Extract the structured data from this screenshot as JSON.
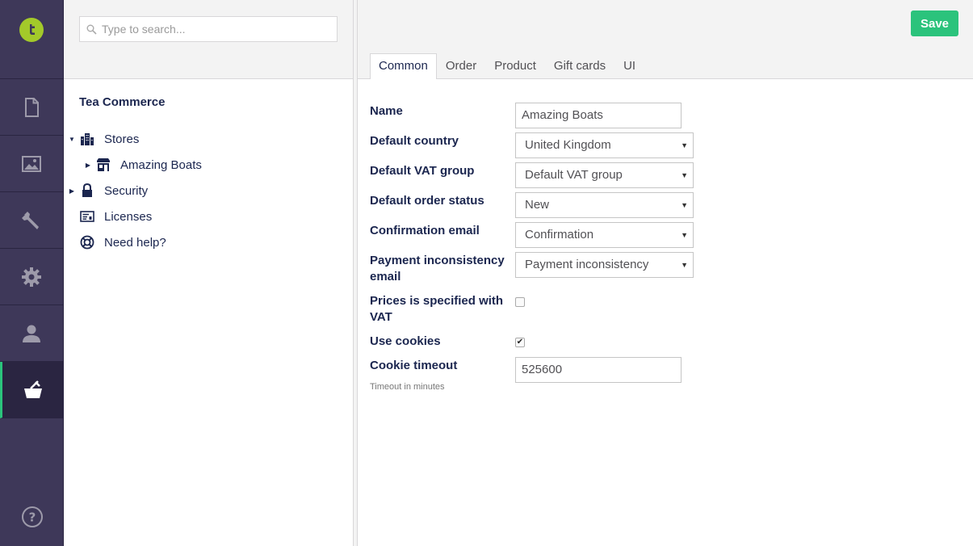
{
  "sections": {
    "logo": "logo-icon",
    "items": [
      {
        "name": "content",
        "icon": "document-icon"
      },
      {
        "name": "media",
        "icon": "image-icon"
      },
      {
        "name": "settings",
        "icon": "wrench-icon"
      },
      {
        "name": "developer",
        "icon": "gear-icon"
      },
      {
        "name": "users",
        "icon": "user-icon"
      },
      {
        "name": "tea-commerce",
        "icon": "basket-icon",
        "active": true
      }
    ],
    "help_icon": "question-icon"
  },
  "tree": {
    "search_placeholder": "Type to search...",
    "title": "Tea Commerce",
    "nodes": [
      {
        "label": "Stores",
        "icon": "stores-icon",
        "expanded": true
      },
      {
        "label": "Amazing Boats",
        "icon": "store-icon",
        "expanded": false
      },
      {
        "label": "Security",
        "icon": "lock-icon",
        "expanded": false
      },
      {
        "label": "Licenses",
        "icon": "license-icon"
      },
      {
        "label": "Need help?",
        "icon": "lifebuoy-icon"
      }
    ]
  },
  "editor": {
    "save_label": "Save",
    "tabs": [
      "Common",
      "Order",
      "Product",
      "Gift cards",
      "UI"
    ],
    "active_tab": "Common",
    "fields": {
      "name": {
        "label": "Name",
        "value": "Amazing Boats"
      },
      "default_country": {
        "label": "Default country",
        "value": "United Kingdom"
      },
      "default_vat_group": {
        "label": "Default VAT group",
        "value": "Default VAT group"
      },
      "default_order_status": {
        "label": "Default order status",
        "value": "New"
      },
      "confirmation_email": {
        "label": "Confirmation email",
        "value": "Confirmation"
      },
      "payment_inconsistency_email": {
        "label_line1": "Payment inconsistency",
        "label_line2": "email",
        "value": "Payment inconsistency"
      },
      "prices_with_vat": {
        "label_line1": "Prices is specified with",
        "label_line2": "VAT",
        "checked": false
      },
      "use_cookies": {
        "label": "Use cookies",
        "checked": true
      },
      "cookie_timeout": {
        "label": "Cookie timeout",
        "description": "Timeout in minutes",
        "value": "525600"
      }
    }
  },
  "colors": {
    "sidebar": "#3e3859",
    "accent": "#2bc37c",
    "logo": "#a3c92a",
    "text": "#1b264f"
  }
}
